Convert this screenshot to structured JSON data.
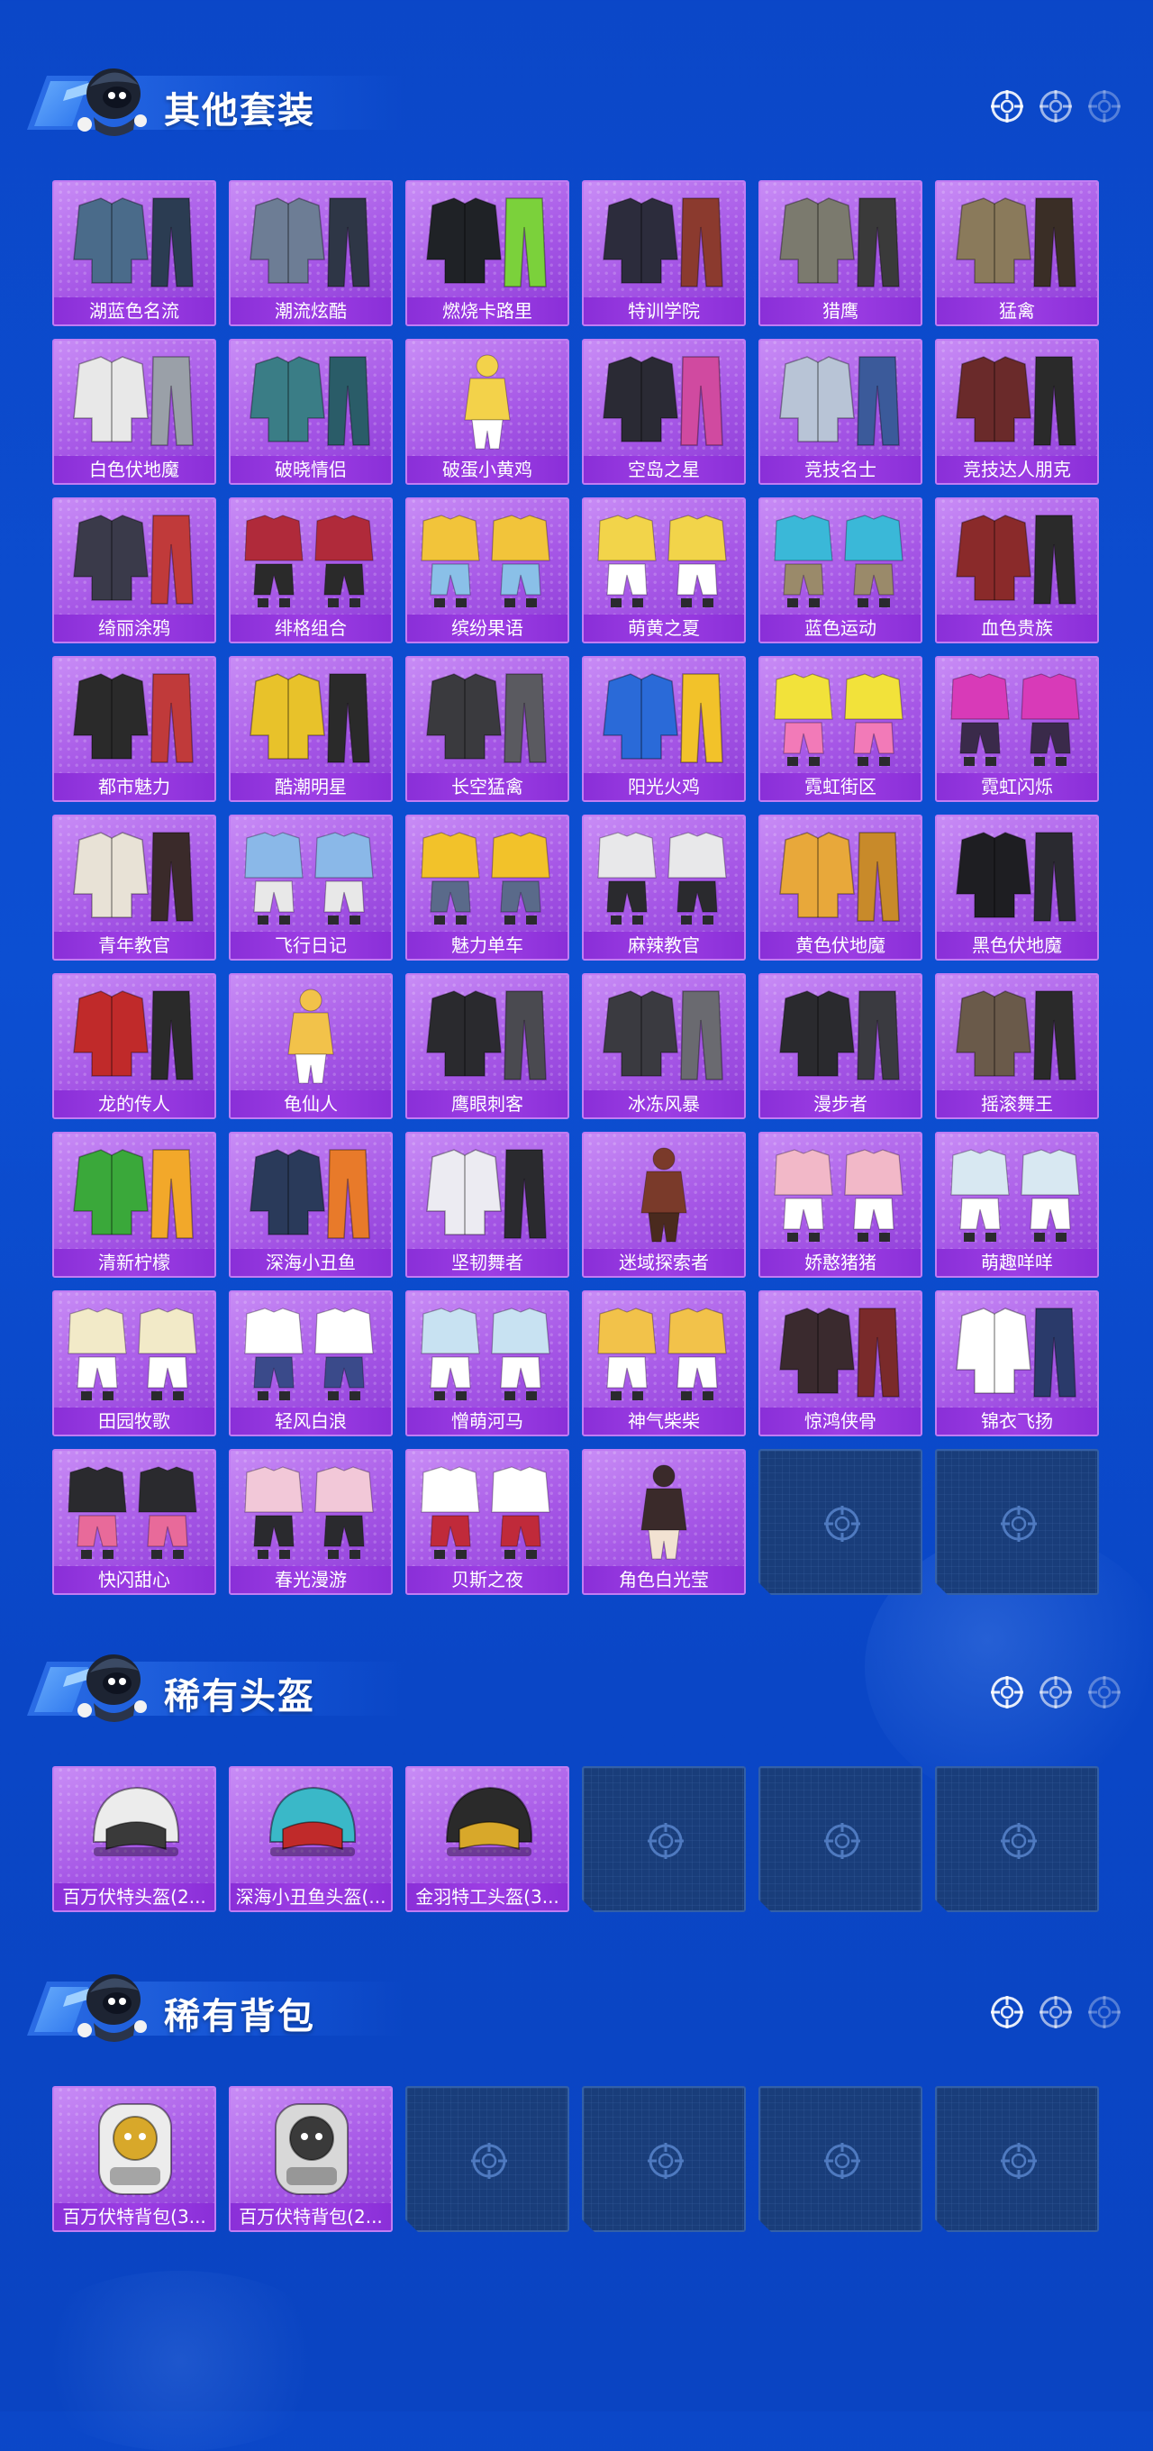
{
  "sections": [
    {
      "title": "其他套装",
      "items": [
        {
          "label": "湖蓝色名流",
          "kind": "suit",
          "c1": "#4a6b8a",
          "c2": "#2b3c52"
        },
        {
          "label": "潮流炫酷",
          "kind": "suit",
          "c1": "#6d7d95",
          "c2": "#2e3646"
        },
        {
          "label": "燃烧卡路里",
          "kind": "suit",
          "c1": "#1f2226",
          "c2": "#7bd13b"
        },
        {
          "label": "特训学院",
          "kind": "suit",
          "c1": "#2c2c3c",
          "c2": "#8b3a2e"
        },
        {
          "label": "猎鹰",
          "kind": "suit",
          "c1": "#7b7a6e",
          "c2": "#3a3a3a"
        },
        {
          "label": "猛禽",
          "kind": "suit",
          "c1": "#8a7a5b",
          "c2": "#3a2e26"
        },
        {
          "label": "白色伏地魔",
          "kind": "suit",
          "c1": "#e8e8e8",
          "c2": "#9aa0a8"
        },
        {
          "label": "破晓情侣",
          "kind": "suit",
          "c1": "#3a7d86",
          "c2": "#2a5c68"
        },
        {
          "label": "破蛋小黄鸡",
          "kind": "figure",
          "c1": "#f3d24a",
          "c2": "#ffffff"
        },
        {
          "label": "空岛之星",
          "kind": "suit",
          "c1": "#2a2a34",
          "c2": "#d04aa0"
        },
        {
          "label": "竞技名士",
          "kind": "suit",
          "c1": "#b8c4d6",
          "c2": "#3b5a9a"
        },
        {
          "label": "竞技达人朋克",
          "kind": "suit",
          "c1": "#6a2a2a",
          "c2": "#2a2a2a"
        },
        {
          "label": "绮丽涂鸦",
          "kind": "suit",
          "c1": "#3a3a4a",
          "c2": "#c03a3a"
        },
        {
          "label": "绯格组合",
          "kind": "set",
          "c1": "#b02a3a",
          "c2": "#2a2a2a"
        },
        {
          "label": "缤纷果语",
          "kind": "set",
          "c1": "#f2c43a",
          "c2": "#8ac0e8"
        },
        {
          "label": "萌黄之夏",
          "kind": "set",
          "c1": "#f2d44a",
          "c2": "#ffffff"
        },
        {
          "label": "蓝色运动",
          "kind": "set",
          "c1": "#3ab8d8",
          "c2": "#9a8a6a"
        },
        {
          "label": "血色贵族",
          "kind": "suit",
          "c1": "#8a2a2a",
          "c2": "#2a2a2a"
        },
        {
          "label": "都市魅力",
          "kind": "suit",
          "c1": "#2a2a2a",
          "c2": "#c03a3a"
        },
        {
          "label": "酷潮明星",
          "kind": "suit",
          "c1": "#e8c22a",
          "c2": "#2a2a2a"
        },
        {
          "label": "长空猛禽",
          "kind": "suit",
          "c1": "#3a3a3e",
          "c2": "#5a5a60"
        },
        {
          "label": "阳光火鸡",
          "kind": "suit",
          "c1": "#2a6ad8",
          "c2": "#f2c22a"
        },
        {
          "label": "霓虹街区",
          "kind": "set",
          "c1": "#f2e23a",
          "c2": "#f27ab8"
        },
        {
          "label": "霓虹闪烁",
          "kind": "set",
          "c1": "#d83ab8",
          "c2": "#3a2a4a"
        },
        {
          "label": "青年教官",
          "kind": "suit",
          "c1": "#e8e2d6",
          "c2": "#3a2a2a"
        },
        {
          "label": "飞行日记",
          "kind": "set",
          "c1": "#8ab8e8",
          "c2": "#e8e8e8"
        },
        {
          "label": "魅力单车",
          "kind": "set",
          "c1": "#f2c22a",
          "c2": "#5a6a8a"
        },
        {
          "label": "麻辣教官",
          "kind": "set",
          "c1": "#e8e8ea",
          "c2": "#2a2a2e"
        },
        {
          "label": "黄色伏地魔",
          "kind": "suit",
          "c1": "#e8a83a",
          "c2": "#c88a2a"
        },
        {
          "label": "黑色伏地魔",
          "kind": "suit",
          "c1": "#1e1e22",
          "c2": "#2a2a30"
        },
        {
          "label": "龙的传人",
          "kind": "suit",
          "c1": "#c02a2a",
          "c2": "#2a2a2a"
        },
        {
          "label": "龟仙人",
          "kind": "figure",
          "c1": "#f2c24a",
          "c2": "#ffffff"
        },
        {
          "label": "鹰眼刺客",
          "kind": "suit",
          "c1": "#2a2a2e",
          "c2": "#4a4a50"
        },
        {
          "label": "冰冻风暴",
          "kind": "suit",
          "c1": "#3a3a40",
          "c2": "#6a6a70"
        },
        {
          "label": "漫步者",
          "kind": "suit",
          "c1": "#2a2a2e",
          "c2": "#3a3a40"
        },
        {
          "label": "摇滚舞王",
          "kind": "suit",
          "c1": "#6a5a4a",
          "c2": "#2a2a2a"
        },
        {
          "label": "清新柠檬",
          "kind": "suit",
          "c1": "#3aa83a",
          "c2": "#f2a82a"
        },
        {
          "label": "深海小丑鱼",
          "kind": "suit",
          "c1": "#2a3a5a",
          "c2": "#e87a2a"
        },
        {
          "label": "坚韧舞者",
          "kind": "suit",
          "c1": "#ecebf2",
          "c2": "#2a2a2e"
        },
        {
          "label": "迷域探索者",
          "kind": "figure",
          "c1": "#7a3a2a",
          "c2": "#4a2a1e"
        },
        {
          "label": "娇憨猪猪",
          "kind": "set",
          "c1": "#f2b8c8",
          "c2": "#ffffff"
        },
        {
          "label": "萌趣咩咩",
          "kind": "set",
          "c1": "#d8e8f2",
          "c2": "#ffffff"
        },
        {
          "label": "田园牧歌",
          "kind": "set",
          "c1": "#f2eac8",
          "c2": "#ffffff"
        },
        {
          "label": "轻风白浪",
          "kind": "set",
          "c1": "#ffffff",
          "c2": "#3a4a8a"
        },
        {
          "label": "憎萌河马",
          "kind": "set",
          "c1": "#c8e2f2",
          "c2": "#ffffff"
        },
        {
          "label": "神气柴柴",
          "kind": "set",
          "c1": "#f2c24a",
          "c2": "#ffffff"
        },
        {
          "label": "惊鸿侠骨",
          "kind": "suit",
          "c1": "#3a2a2e",
          "c2": "#7a2a2a"
        },
        {
          "label": "锦衣飞扬",
          "kind": "suit",
          "c1": "#ffffff",
          "c2": "#2a3a6a"
        },
        {
          "label": "快闪甜心",
          "kind": "set",
          "c1": "#2a2a2e",
          "c2": "#e86a9a"
        },
        {
          "label": "春光漫游",
          "kind": "set",
          "c1": "#f2c8d8",
          "c2": "#2a2a2e"
        },
        {
          "label": "贝斯之夜",
          "kind": "set",
          "c1": "#ffffff",
          "c2": "#c02a3a"
        },
        {
          "label": "角色白光莹",
          "kind": "figure",
          "c1": "#3a2a2a",
          "c2": "#f2e2d2"
        },
        {
          "label": "",
          "kind": "empty"
        },
        {
          "label": "",
          "kind": "empty"
        }
      ]
    },
    {
      "title": "稀有头盔",
      "items": [
        {
          "label": "百万伏特头盔(2...",
          "kind": "helmet",
          "c1": "#ececec",
          "c2": "#3a3a3a"
        },
        {
          "label": "深海小丑鱼头盔(...",
          "kind": "helmet",
          "c1": "#3ab8c8",
          "c2": "#c02a2a"
        },
        {
          "label": "金羽特工头盔(3...",
          "kind": "helmet",
          "c1": "#2a2a2a",
          "c2": "#d8a82a"
        },
        {
          "label": "",
          "kind": "empty"
        },
        {
          "label": "",
          "kind": "empty"
        },
        {
          "label": "",
          "kind": "empty"
        }
      ]
    },
    {
      "title": "稀有背包",
      "items": [
        {
          "label": "百万伏特背包(3...",
          "kind": "backpack",
          "c1": "#ececec",
          "c2": "#d8a82a"
        },
        {
          "label": "百万伏特背包(2...",
          "kind": "backpack",
          "c1": "#d8d8d8",
          "c2": "#3a3a3a"
        },
        {
          "label": "",
          "kind": "empty"
        },
        {
          "label": "",
          "kind": "empty"
        },
        {
          "label": "",
          "kind": "empty"
        },
        {
          "label": "",
          "kind": "empty"
        }
      ]
    }
  ]
}
